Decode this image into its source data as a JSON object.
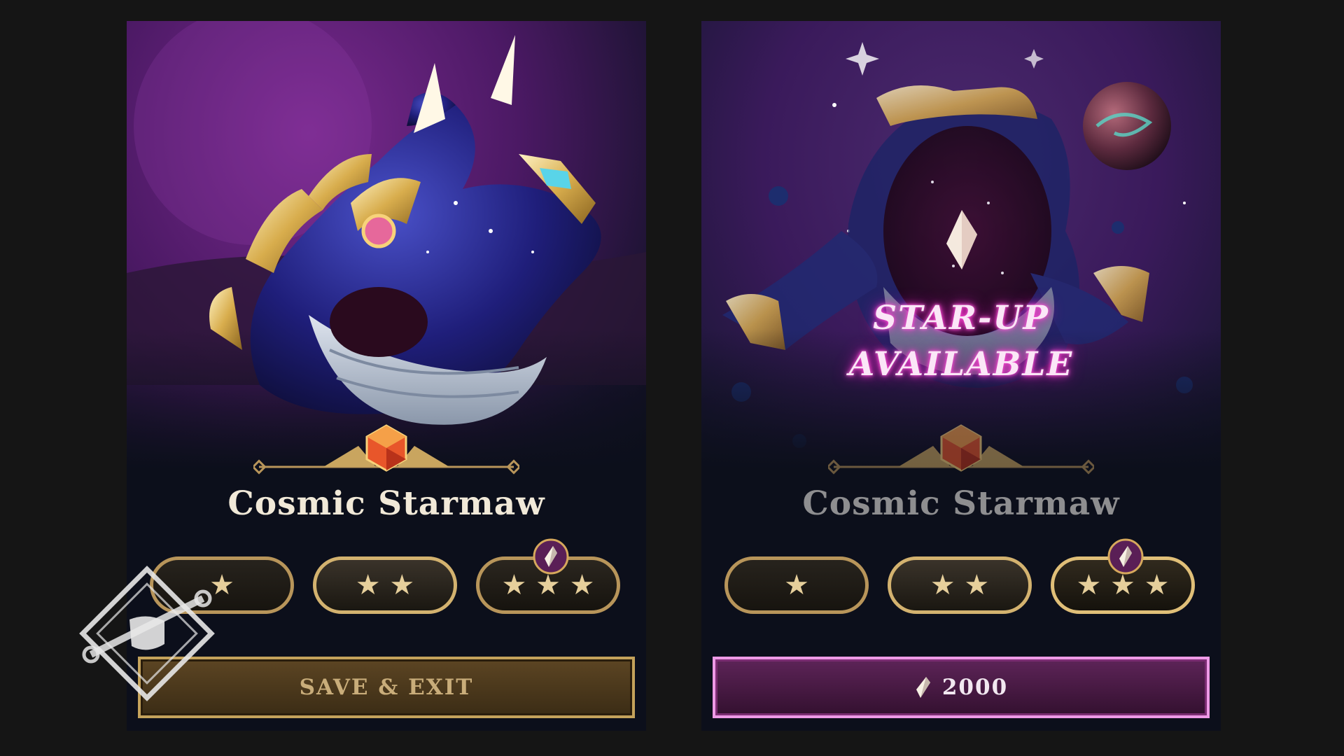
{
  "cards": [
    {
      "name": "Cosmic Starmaw",
      "tiers": [
        "★",
        "★ ★",
        "★ ★ ★"
      ],
      "action_label": "SAVE & EXIT",
      "selected_tier": 2
    },
    {
      "name": "Cosmic Starmaw",
      "overlay": [
        "STAR-UP",
        "AVAILABLE"
      ],
      "tiers": [
        "★",
        "★ ★",
        "★ ★ ★"
      ],
      "action_label": "2000",
      "selected_tier": 3
    }
  ],
  "icons": {
    "rarity": "hexagon-gem-icon",
    "cost": "crystal-shard-icon",
    "watermark": "fist-wrench-logo"
  },
  "colors": {
    "gold_border": "#b8955a",
    "purple_button": "#5d2458",
    "pink_border": "#ee9ae6",
    "glow": "#ff3ed0"
  }
}
